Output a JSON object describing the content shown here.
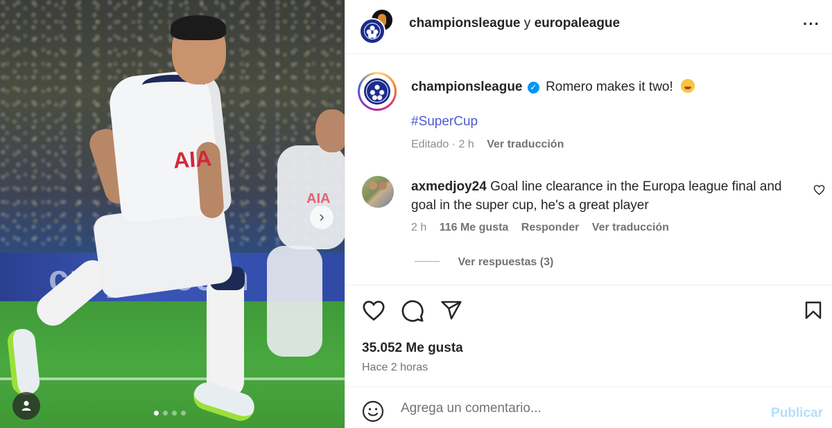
{
  "header": {
    "user1": "championsleague",
    "joiner": "y",
    "user2": "europaleague",
    "more_icon": "more-horizontal-icon"
  },
  "media": {
    "ad_text": "crypto.com",
    "sponsor": "AIA",
    "next_icon": "chevron-right-icon",
    "carousel_count": 4,
    "carousel_active": 0,
    "tag_icon": "user-tag-icon"
  },
  "caption": {
    "username": "championsleague",
    "text": "Romero makes it two!",
    "hashtag": "#SuperCup",
    "edited": "Editado",
    "dot": "·",
    "time": "2 h",
    "translate": "Ver traducción"
  },
  "comment": {
    "username": "axmedjoy24",
    "text": "Goal line clearance in the Europa league final and goal in the super cup, he's a great player",
    "time": "2 h",
    "likes": "116 Me gusta",
    "reply": "Responder",
    "translate": "Ver traducción",
    "view_replies": "Ver respuestas (3)"
  },
  "actions": {
    "likes_count": "35.052 Me gusta",
    "posted_ago": "Hace 2 horas"
  },
  "add_comment": {
    "placeholder": "Agrega un comentario...",
    "publish": "Publicar"
  },
  "colors": {
    "link": "#4a5bd4",
    "verified": "#0095f6",
    "publish_disabled": "#b2dffc"
  }
}
